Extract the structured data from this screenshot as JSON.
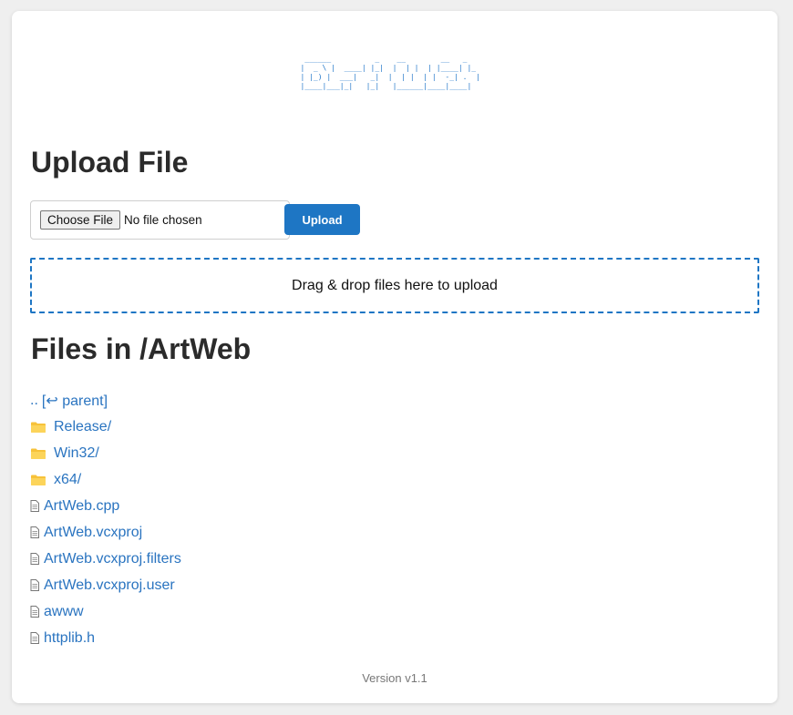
{
  "logo_ascii": " ______          _    __        __   _     \n|  _ \\ |  ____| |_|  |  | |  | |____| |_  \n| |_) |  ___|   _|  |  | |  | |  -_| .  | \n|____|___|_|   |_|   |______|____|____|",
  "upload": {
    "heading": "Upload File",
    "choose_label": "Choose File",
    "no_file_text": "No file chosen",
    "upload_label": "Upload",
    "dropzone_text": "Drag & drop files here to upload"
  },
  "listing": {
    "heading": "Files in /ArtWeb",
    "parent": {
      "dots": "..",
      "open": "[",
      "icon": "↩",
      "label": " parent]"
    },
    "folders": [
      {
        "name": "Release/"
      },
      {
        "name": "Win32/"
      },
      {
        "name": "x64/"
      }
    ],
    "files": [
      {
        "name": "ArtWeb.cpp"
      },
      {
        "name": "ArtWeb.vcxproj"
      },
      {
        "name": "ArtWeb.vcxproj.filters"
      },
      {
        "name": "ArtWeb.vcxproj.user"
      },
      {
        "name": "awww"
      },
      {
        "name": "httplib.h"
      }
    ]
  },
  "footer": {
    "version": "Version v1.1"
  },
  "colors": {
    "accent": "#1e76c4",
    "link": "#2a74c0",
    "folder": "#f7c23a"
  }
}
